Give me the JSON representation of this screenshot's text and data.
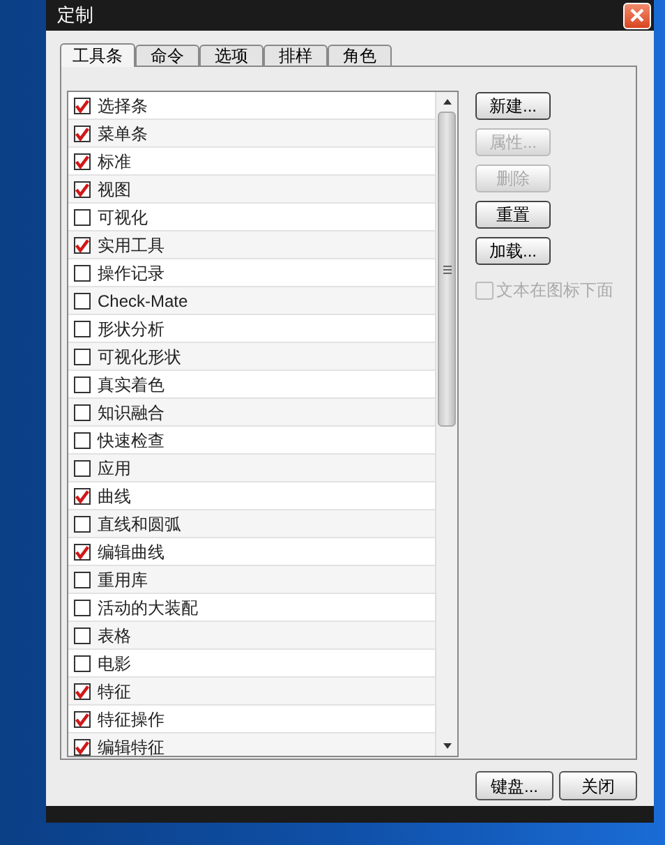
{
  "window": {
    "title": "定制"
  },
  "tabs": [
    {
      "label": "工具条",
      "selected": true
    },
    {
      "label": "命令",
      "selected": false
    },
    {
      "label": "选项",
      "selected": false
    },
    {
      "label": "排样",
      "selected": false
    },
    {
      "label": "角色",
      "selected": false
    }
  ],
  "toolbars": [
    {
      "label": "选择条",
      "checked": true
    },
    {
      "label": "菜单条",
      "checked": true
    },
    {
      "label": "标准",
      "checked": true
    },
    {
      "label": "视图",
      "checked": true
    },
    {
      "label": "可视化",
      "checked": false
    },
    {
      "label": "实用工具",
      "checked": true
    },
    {
      "label": "操作记录",
      "checked": false
    },
    {
      "label": "Check-Mate",
      "checked": false
    },
    {
      "label": "形状分析",
      "checked": false
    },
    {
      "label": "可视化形状",
      "checked": false
    },
    {
      "label": "真实着色",
      "checked": false
    },
    {
      "label": "知识融合",
      "checked": false
    },
    {
      "label": "快速检查",
      "checked": false
    },
    {
      "label": "应用",
      "checked": false
    },
    {
      "label": "曲线",
      "checked": true
    },
    {
      "label": "直线和圆弧",
      "checked": false
    },
    {
      "label": "编辑曲线",
      "checked": true
    },
    {
      "label": "重用库",
      "checked": false
    },
    {
      "label": "活动的大装配",
      "checked": false
    },
    {
      "label": "表格",
      "checked": false
    },
    {
      "label": "电影",
      "checked": false
    },
    {
      "label": "特征",
      "checked": true
    },
    {
      "label": "特征操作",
      "checked": true
    },
    {
      "label": "编辑特征",
      "checked": true
    }
  ],
  "side_buttons": [
    {
      "label": "新建...",
      "disabled": false
    },
    {
      "label": "属性...",
      "disabled": true
    },
    {
      "label": "删除",
      "disabled": true
    },
    {
      "label": "重置",
      "disabled": false
    },
    {
      "label": "加载...",
      "disabled": false
    }
  ],
  "text_below_icon": {
    "label": "文本在图标下面",
    "checked": false,
    "disabled": true
  },
  "footer_buttons": [
    "键盘...",
    "关闭"
  ]
}
